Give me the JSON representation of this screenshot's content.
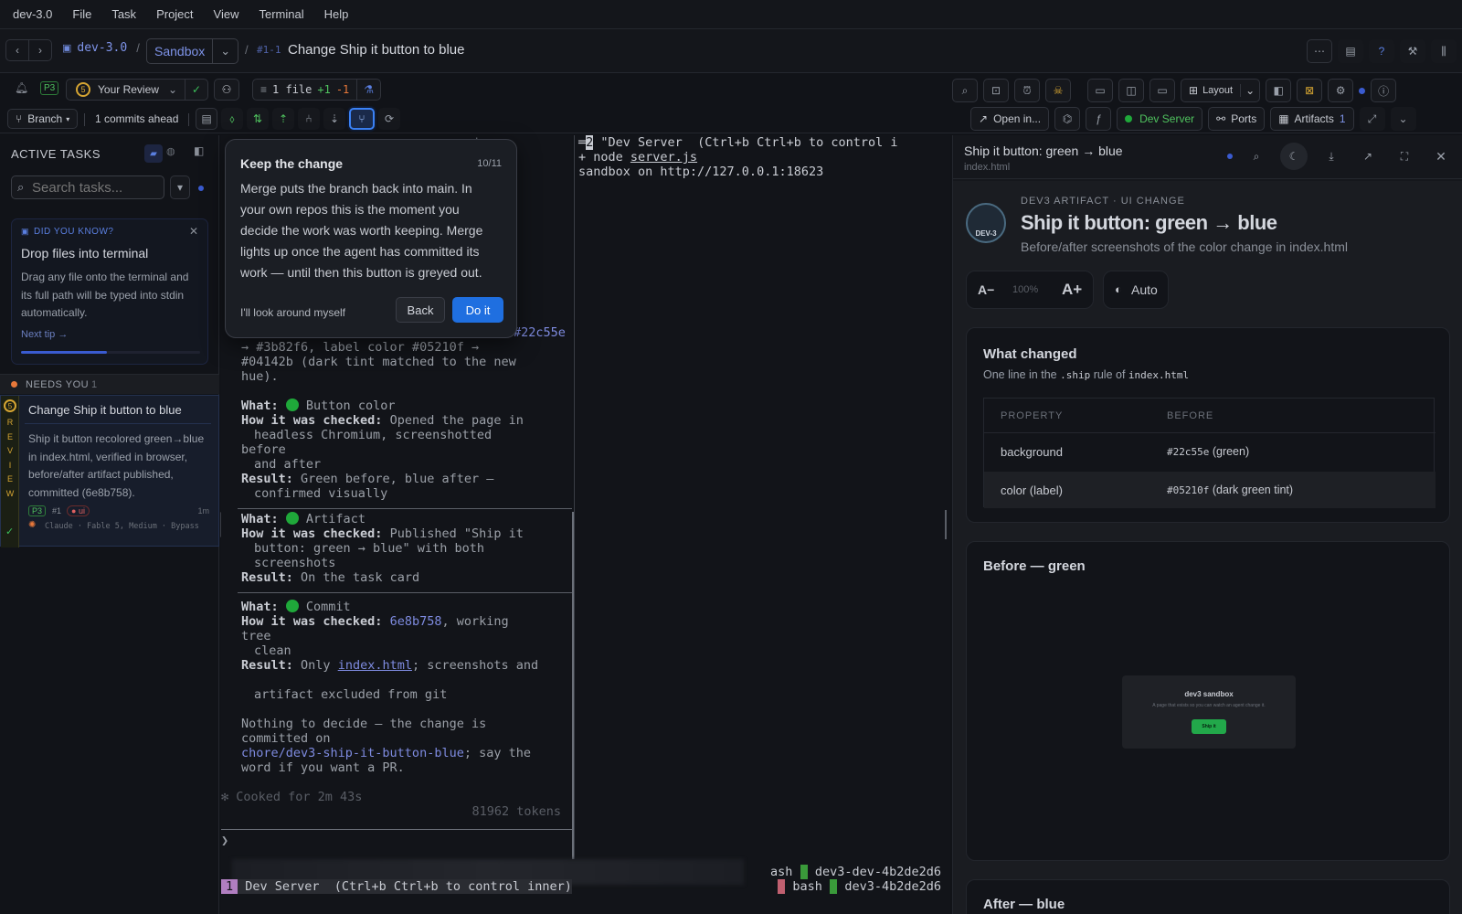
{
  "menu": [
    "dev-3.0",
    "File",
    "Task",
    "Project",
    "View",
    "Terminal",
    "Help"
  ],
  "header": {
    "project": "dev-3.0",
    "sep": "/",
    "env": "Sandbox",
    "task_id": "#1-1",
    "task_title": "Change Ship it button to blue"
  },
  "toolbar": {
    "priority": "P3",
    "review_count": "5",
    "review_label": "Your Review",
    "files_label": "1 file",
    "adds": "+1",
    "dels": "-1",
    "branch": "Branch",
    "commits_ahead": "1 commits ahead",
    "open_in": "Open in...",
    "dev_server": "Dev Server",
    "ports": "Ports",
    "artifacts": "Artifacts",
    "artifacts_count": "1",
    "layout": "Layout"
  },
  "sidebar": {
    "heading": "ACTIVE TASKS",
    "search_placeholder": "Search tasks...",
    "tip": {
      "label": "DID YOU KNOW?",
      "title": "Drop files into terminal",
      "body": "Drag any file onto the terminal and its full path will be typed into stdin automatically.",
      "next": "Next tip →"
    },
    "needs_you": {
      "label": "NEEDS YOU",
      "count": "1"
    },
    "task": {
      "badge_letters": [
        "R",
        "E",
        "V",
        "I",
        "E",
        "W"
      ],
      "badge_num": "5",
      "title": "Change Ship it button to blue",
      "desc": "Ship it button recolored green→blue in index.html, verified in browser, before/after artifact published, committed (6e8b758).",
      "priority": "P3",
      "id": "#1",
      "tag": "ui",
      "age": "1m",
      "agent": "Claude · Fable 5, Medium · Bypass"
    }
  },
  "terminal_left": {
    "partial_lines": [
      "→ #3b82f6, label color #05210f →",
      "#04142b (dark tint matched to the new",
      "hue)."
    ],
    "top_hex": "#22c55e",
    "checks": [
      {
        "what": "Button color",
        "how": "Opened the page in",
        "how2": "headless Chromium, screenshotted",
        "how3": "before",
        "how4": "and after",
        "result": "Green before, blue after —",
        "result2": "confirmed visually"
      },
      {
        "what": "Artifact",
        "how": "Published \"Ship it",
        "how2": "button: green → blue\" with both",
        "how3": "screenshots",
        "result": "On the task card"
      },
      {
        "what": "Commit",
        "how_hash": "6e8b758",
        "how_rest": ", working",
        "how2": "tree",
        "how3": "clean",
        "result_pre": "Only ",
        "result_file": "index.html",
        "result_post": "; screenshots and",
        "result2": "artifact excluded from git"
      }
    ],
    "labels": {
      "what": "What:",
      "how": "How it was checked:",
      "result": "Result:"
    },
    "summary1": "Nothing to decide — the change is",
    "summary2": "committed on",
    "branch_name": "chore/dev3-ship-it-button-blue",
    "summary3": "; say the",
    "summary4": "word if you want a PR.",
    "cooked": "✻ Cooked for 2m 43s",
    "tokens": "81962 tokens",
    "prompt": "❯"
  },
  "terminal_right": {
    "line1_num": "2",
    "line1": " \"Dev Server  (Ctrl+b Ctrl+b to control i",
    "line2": "+ node server.js",
    "line3": "sandbox on http://127.0.0.1:18623",
    "status_a": "ash",
    "status_b": "dev3-dev-4b2de2d6",
    "status_c": "bash",
    "status_d": "dev3-4b2de2d6",
    "tmux_win": "1",
    "tmux_title": " Dev Server  (Ctrl+b Ctrl+b to control inner)"
  },
  "popover": {
    "title": "Keep the change",
    "step": "10/11",
    "body": "Merge puts the branch back into main. In your own repos this is the moment you decide the work was worth keeping. Merge lights up once the agent has committed its work — until then this button is greyed out.",
    "skip": "I'll look around myself",
    "back": "Back",
    "primary": "Do it"
  },
  "artifact": {
    "title": "Ship it button: green → blue",
    "file": "index.html",
    "kicker": "DEV3 ARTIFACT · UI CHANGE",
    "heading": "Ship it button: green → blue",
    "subtitle": "Before/after screenshots of the color change in index.html",
    "font_minus": "A−",
    "font_pct": "100%",
    "font_plus": "A+",
    "theme": "Auto",
    "logo_text": "DEV-3",
    "changed": {
      "title": "What changed",
      "desc_pre": "One line in the ",
      "desc_code1": ".ship",
      "desc_mid": " rule of ",
      "desc_code2": "index.html",
      "col1": "PROPERTY",
      "col2": "BEFORE",
      "rows": [
        {
          "prop": "background",
          "code": "#22c55e",
          "note": " (green)"
        },
        {
          "prop": "color (label)",
          "code": "#05210f",
          "note": " (dark green tint)"
        }
      ]
    },
    "before": {
      "title": "Before — green",
      "shot_title": "dev3 sandbox",
      "shot_sub": "A page that exists so you can watch an agent change it.",
      "shot_btn": "Ship it"
    },
    "after_title": "After — blue"
  },
  "colors": {
    "accent": "#1f6fe0",
    "green": "#1fa83a",
    "hex": "#7e8be0",
    "orange": "#e8783a"
  }
}
